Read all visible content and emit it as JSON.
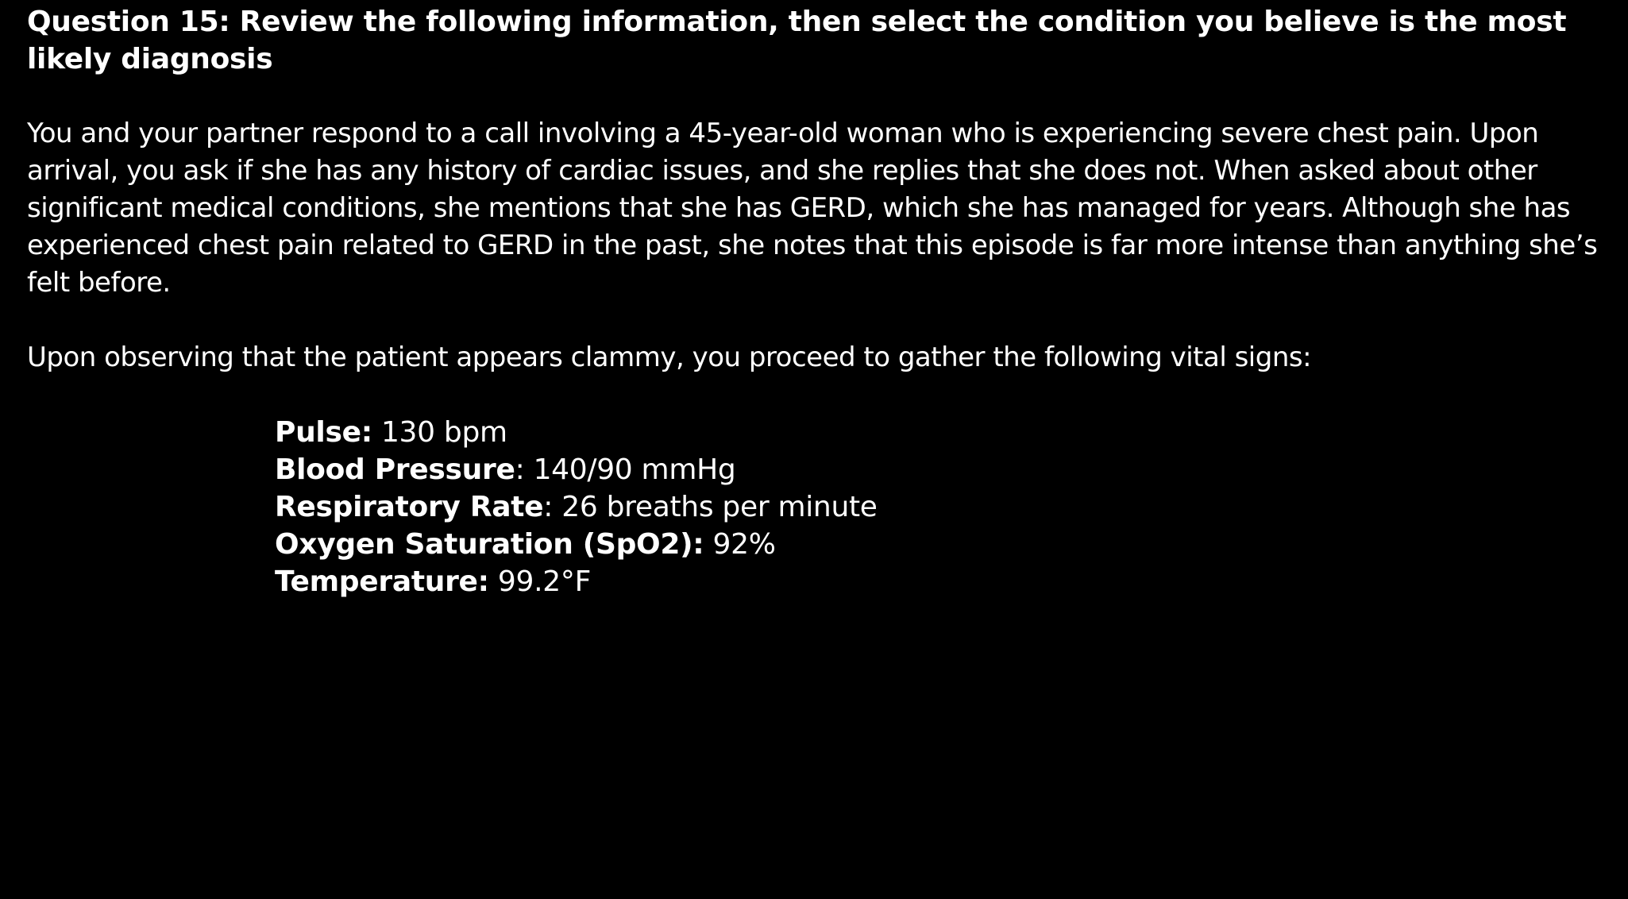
{
  "question": {
    "title": "Question 15: Review the following information, then select the condition you believe is the most likely diagnosis"
  },
  "scenario": {
    "text": "You and your partner respond to a call involving a 45-year-old woman who is experiencing severe chest pain. Upon arrival, you ask if she has any history of cardiac issues, and she replies that she does not. When asked about other significant medical conditions, she mentions that she has GERD, which she has managed for years. Although she has experienced chest pain related to GERD in the past, she notes that this episode is far more intense than anything she’s felt before.",
    "observation": "Upon observing that the patient appears clammy, you proceed to gather the following vital signs:"
  },
  "vitals": {
    "pulse": {
      "label": "Pulse:",
      "sep": "",
      "value": "130 bpm"
    },
    "blood_pressure": {
      "label": "Blood Pressure",
      "sep": ":",
      "value": "140/90 mmHg"
    },
    "respiratory_rate": {
      "label": "Respiratory Rate",
      "sep": ":",
      "value": "26 breaths per minute"
    },
    "oxygen_saturation": {
      "label": "Oxygen Saturation (SpO2):",
      "sep": "",
      "value": "92%"
    },
    "temperature": {
      "label": "Temperature:",
      "sep": "",
      "value": "99.2°F"
    }
  }
}
